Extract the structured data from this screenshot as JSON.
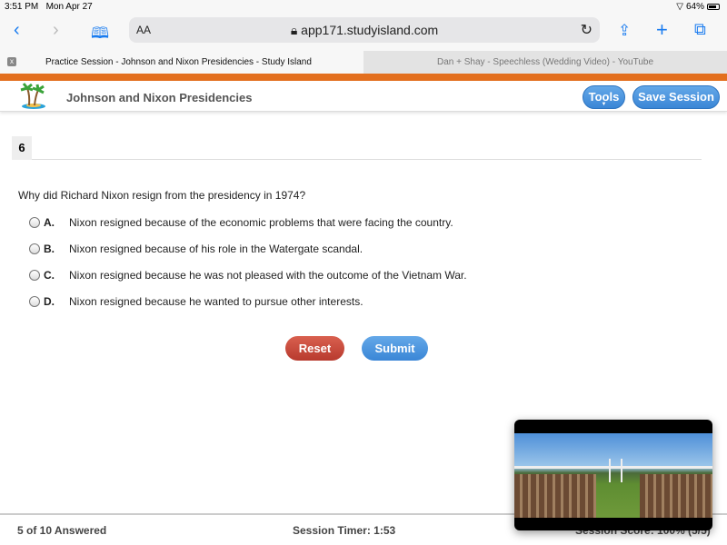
{
  "status": {
    "time": "3:51 PM",
    "date": "Mon Apr 27",
    "battery": "64%",
    "battery_level": 64
  },
  "browser": {
    "text_size": "AA",
    "url": "app171.studyisland.com",
    "tabs": [
      {
        "label": "Practice Session - Johnson and Nixon Presidencies - Study Island",
        "active": true
      },
      {
        "label": "Dan + Shay - Speechless (Wedding Video) - YouTube",
        "active": false
      }
    ]
  },
  "header": {
    "title": "Johnson and Nixon Presidencies",
    "tools": "Tools",
    "save": "Save Session"
  },
  "question": {
    "number": "6",
    "text": "Why did Richard Nixon resign from the presidency in 1974?",
    "options": [
      {
        "letter": "A.",
        "text": "Nixon resigned because of the economic problems that were facing the country."
      },
      {
        "letter": "B.",
        "text": "Nixon resigned because of his role in the Watergate scandal."
      },
      {
        "letter": "C.",
        "text": "Nixon resigned because he was not pleased with the outcome of the Vietnam War."
      },
      {
        "letter": "D.",
        "text": "Nixon resigned because he wanted to pursue other interests."
      }
    ]
  },
  "actions": {
    "reset": "Reset",
    "submit": "Submit"
  },
  "colors": {
    "orange": "#e36f1e",
    "blue": "#3a86d6",
    "reset": "#c9453a"
  },
  "footer": {
    "answered": "5 of 10 Answered",
    "timer": "Session Timer: 1:53",
    "score": "Session Score: 100% (5/5)"
  }
}
